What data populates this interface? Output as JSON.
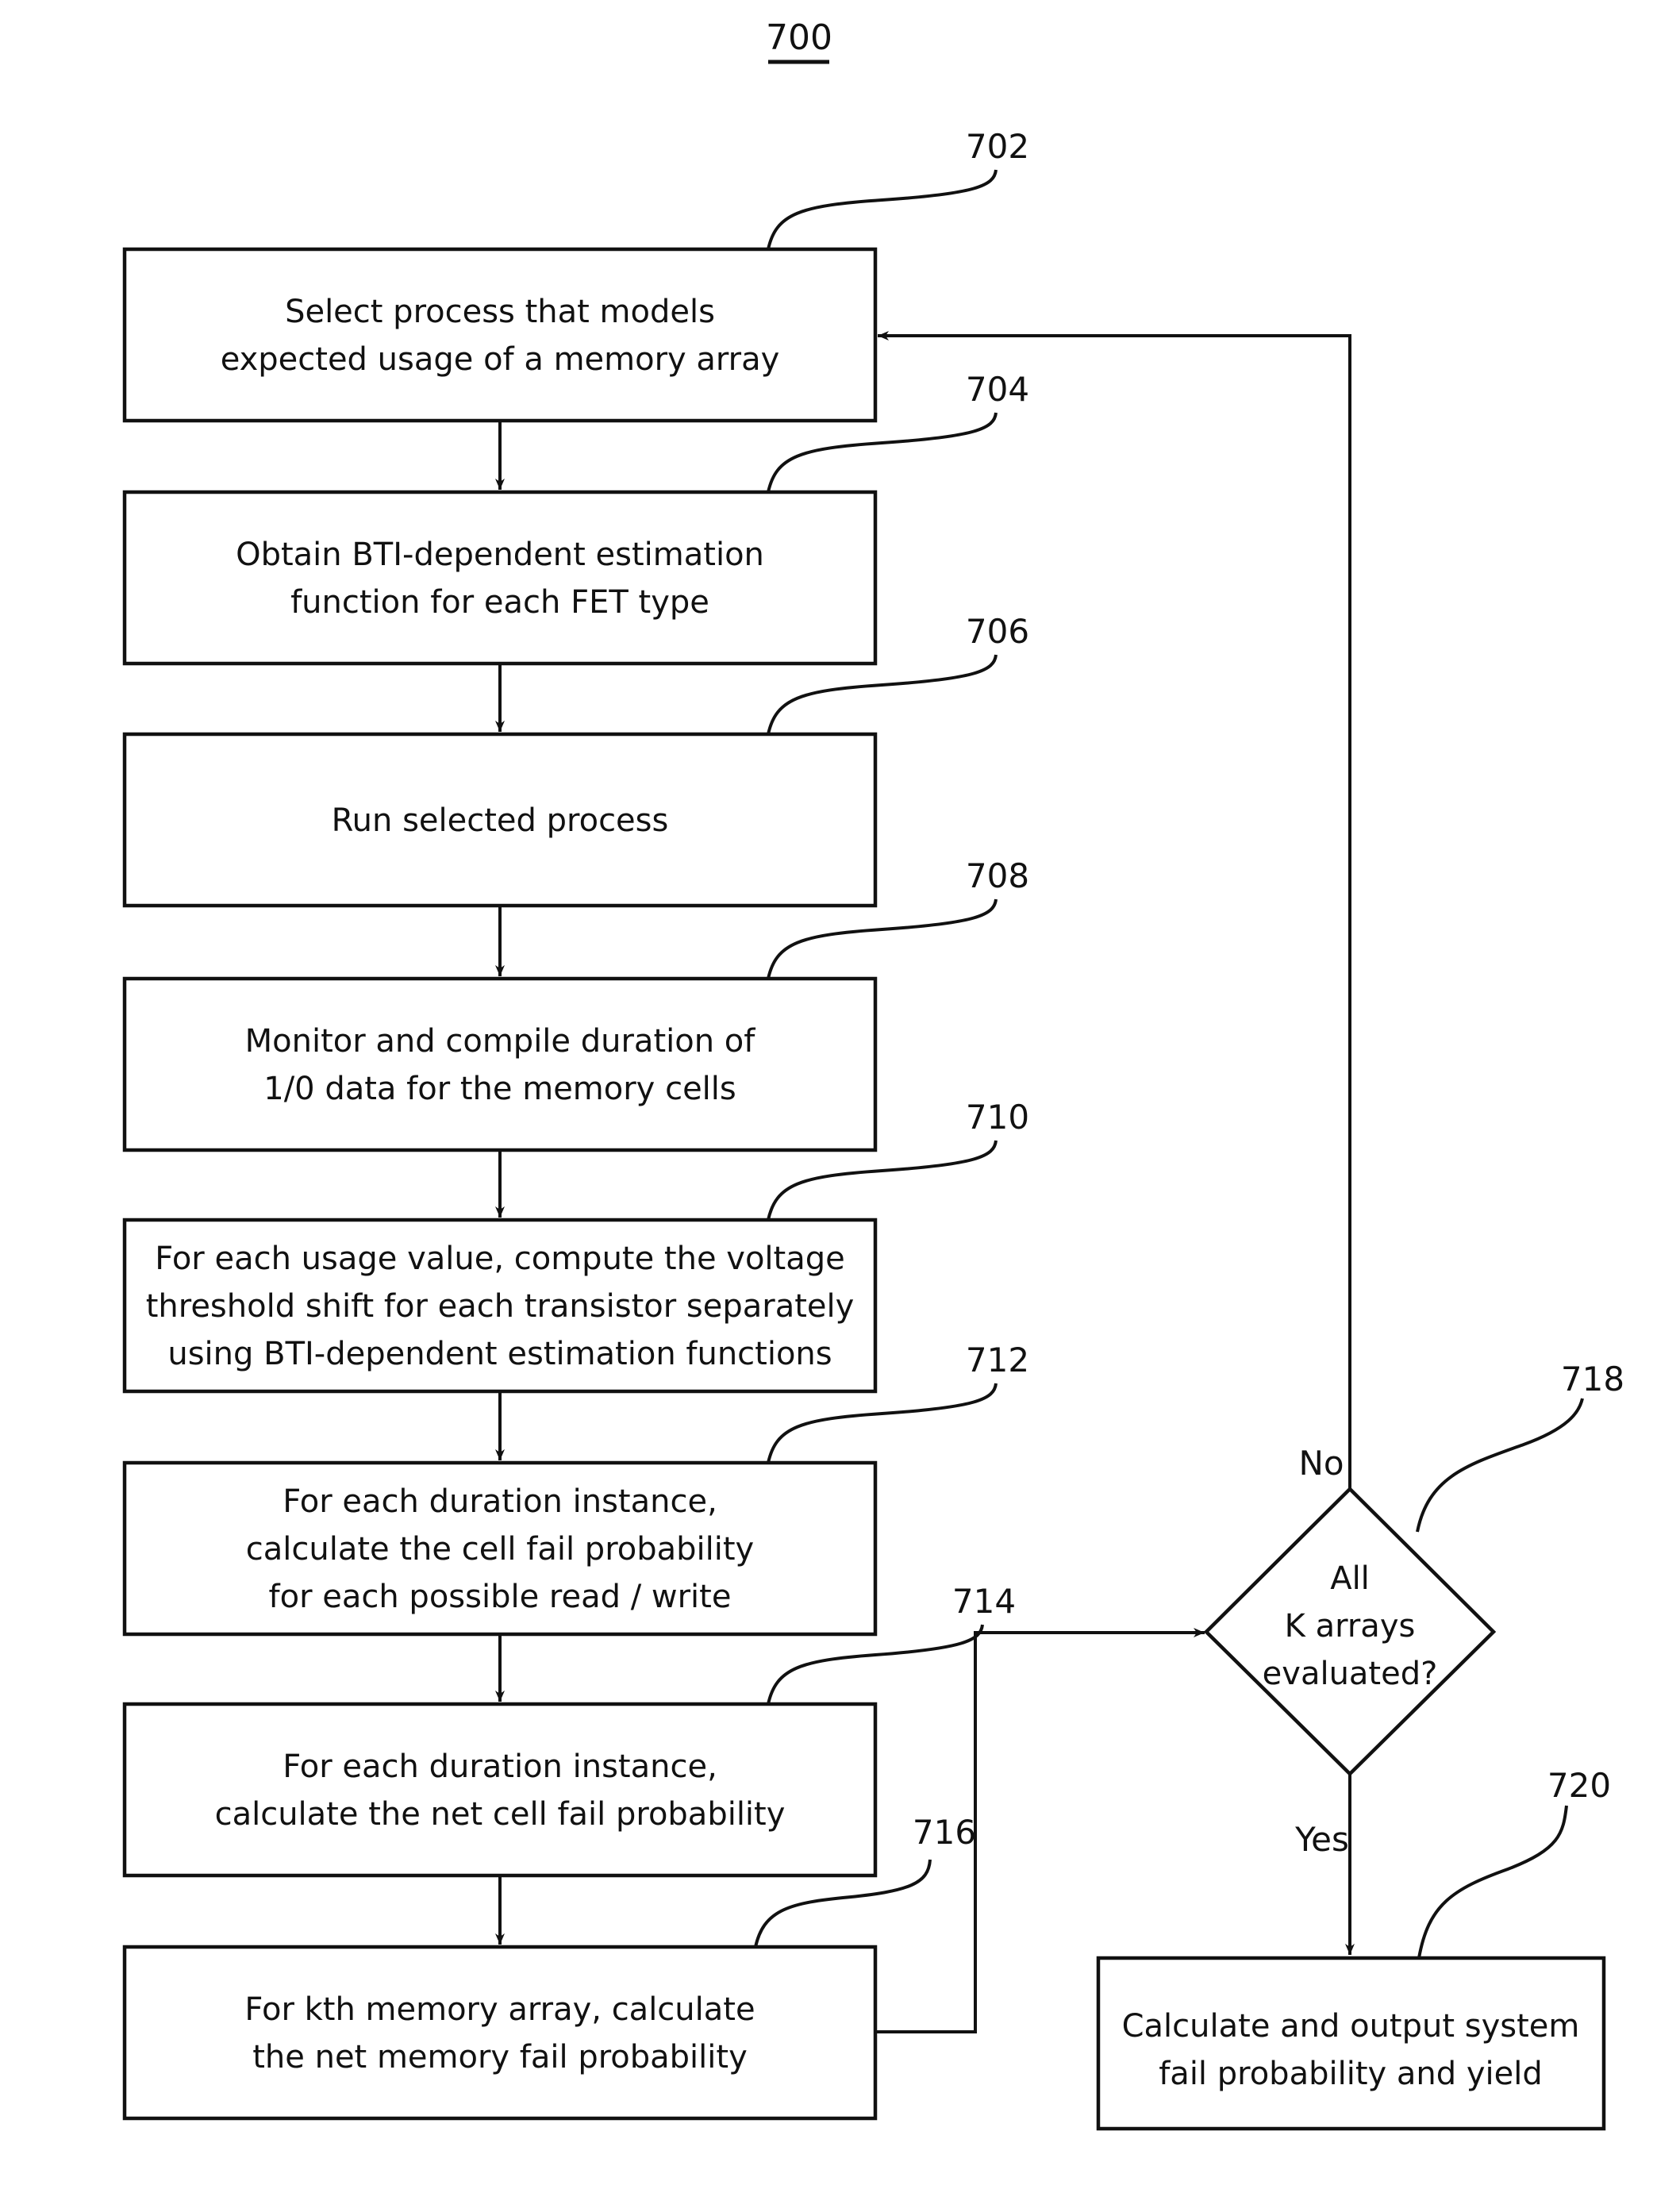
{
  "figure": {
    "number": "700"
  },
  "steps": [
    {
      "ref": "702",
      "lines": [
        "Select process that models",
        "expected usage of a memory array"
      ]
    },
    {
      "ref": "704",
      "lines": [
        "Obtain BTI-dependent estimation",
        "function for each FET type"
      ]
    },
    {
      "ref": "706",
      "lines": [
        "Run selected process"
      ]
    },
    {
      "ref": "708",
      "lines": [
        "Monitor and compile duration of",
        "1/0 data for the memory cells"
      ]
    },
    {
      "ref": "710",
      "lines": [
        "For each usage value, compute the voltage",
        "threshold shift for each transistor separately",
        "using BTI-dependent estimation functions"
      ]
    },
    {
      "ref": "712",
      "lines": [
        "For each duration instance,",
        "calculate the cell fail probability",
        "for each possible read / write"
      ]
    },
    {
      "ref": "714",
      "lines": [
        "For each duration instance,",
        "calculate the net cell fail probability"
      ]
    },
    {
      "ref": "716",
      "lines": [
        "For kth memory array, calculate",
        "the net memory fail probability"
      ]
    }
  ],
  "decision": {
    "ref": "718",
    "lines": [
      "All",
      "K arrays",
      "evaluated?"
    ],
    "no_label": "No",
    "yes_label": "Yes"
  },
  "output_step": {
    "ref": "720",
    "lines": [
      "Calculate and output system",
      "fail probability and yield"
    ]
  }
}
